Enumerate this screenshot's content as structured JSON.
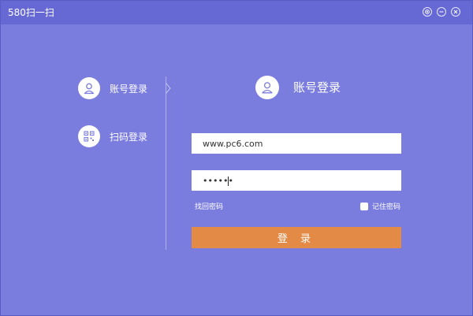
{
  "window": {
    "title": "580扫一扫",
    "controls": [
      "settings",
      "minimize",
      "close"
    ]
  },
  "nav": {
    "items": [
      {
        "label": "账号登录",
        "icon": "user-icon"
      },
      {
        "label": "扫码登录",
        "icon": "qr-code-icon"
      }
    ]
  },
  "login": {
    "title": "账号登录",
    "username_value": "www.pc6.com",
    "password_value": "••••••",
    "forgot_label": "找回密码",
    "remember_label": "记住密码",
    "submit_label": "登 录"
  },
  "colors": {
    "background": "#7b7dde",
    "titlebar": "#6668d4",
    "button": "#e38b46"
  }
}
